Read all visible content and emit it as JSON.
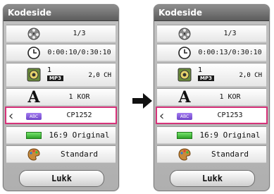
{
  "panels": [
    {
      "title": "Kodeside",
      "rows": [
        {
          "icon": "film-reel-icon",
          "value": "1/3"
        },
        {
          "icon": "clock-icon",
          "value": "0:00:10/0:30:10"
        },
        {
          "icon": "speaker-icon",
          "track": "1",
          "format": "MP3",
          "channels": "2,0 CH"
        },
        {
          "icon": "letter-a-icon",
          "letter": "A",
          "value": "1 KOR"
        },
        {
          "icon": "abc-icon",
          "icon_text": "ABC",
          "value": "CP1252",
          "selected": true
        },
        {
          "icon": "aspect-ratio-icon",
          "value": "16:9 Original"
        },
        {
          "icon": "palette-icon",
          "value": "Standard"
        }
      ],
      "close_label": "Lukk"
    },
    {
      "title": "Kodeside",
      "rows": [
        {
          "icon": "film-reel-icon",
          "value": "1/3"
        },
        {
          "icon": "clock-icon",
          "value": "0:00:13/0:30:10"
        },
        {
          "icon": "speaker-icon",
          "track": "1",
          "format": "MP3",
          "channels": "2,0 CH"
        },
        {
          "icon": "letter-a-icon",
          "letter": "A",
          "value": "1 KOR"
        },
        {
          "icon": "abc-icon",
          "icon_text": "ABC",
          "value": "CP1253",
          "selected": true
        },
        {
          "icon": "aspect-ratio-icon",
          "value": "16:9 Original"
        },
        {
          "icon": "palette-icon",
          "value": "Standard"
        }
      ],
      "close_label": "Lukk"
    }
  ],
  "colors": {
    "selection": "#d6337a",
    "title_bar": "#6f6f6f"
  }
}
